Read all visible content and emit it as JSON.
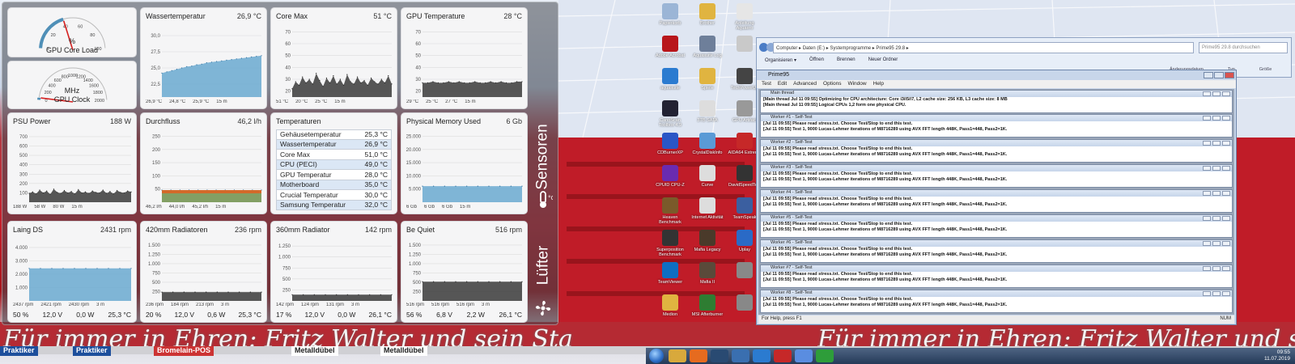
{
  "colors": {
    "accent": "#4f8fb7",
    "chart_fill": "#6aa9d0",
    "chart_dark": "#3a3a3a",
    "needle": "#d62020"
  },
  "gauges": [
    {
      "name": "GPU Core Load",
      "unit": "%",
      "ticks": [
        "0",
        "20",
        "40",
        "60",
        "80",
        "100"
      ],
      "level": 0.4
    },
    {
      "name": "GPU Clock",
      "unit": "MHz",
      "ticks": [
        "0",
        "200",
        "400",
        "600",
        "800",
        "1000",
        "1200",
        "1400",
        "1600",
        "1800",
        "2000"
      ],
      "level": 0.02
    }
  ],
  "tiles": {
    "wassertemperatur": {
      "title": "Wassertemperatur",
      "value": "26,9 °C",
      "chart_data": {
        "type": "area",
        "yticks": [
          "30,0",
          "27,5",
          "25,0",
          "22,5"
        ],
        "ylim": [
          20.5,
          31.5
        ],
        "values": [
          24.2,
          24.4,
          24.6,
          24.8,
          25.0,
          25.2,
          25.3,
          25.5,
          25.6,
          25.8,
          25.9,
          26.0,
          26.1,
          26.2,
          26.3,
          26.4,
          26.5,
          26.6,
          26.7,
          26.8,
          26.9
        ]
      },
      "footer": [
        "26,9 °C",
        "24,8 °C",
        "25,9 °C",
        "15 m"
      ]
    },
    "coremax": {
      "title": "Core Max",
      "value": "51 °C",
      "chart_data": {
        "type": "area",
        "yticks": [
          "70",
          "60",
          "50",
          "40",
          "30",
          "20"
        ],
        "ylim": [
          15,
          75
        ],
        "values": [
          22,
          28,
          25,
          32,
          27,
          30,
          26,
          35,
          29,
          24,
          31,
          27,
          33,
          26,
          30,
          25,
          34,
          28,
          26,
          32,
          27,
          29,
          25,
          31,
          28,
          26,
          30,
          27,
          33,
          26
        ]
      },
      "footer": [
        "51 °C",
        "20 °C",
        "25 °C",
        "15 m"
      ]
    },
    "gputemp": {
      "title": "GPU Temperature",
      "value": "28 °C",
      "chart_data": {
        "type": "area",
        "yticks": [
          "70",
          "60",
          "50",
          "40",
          "30",
          "20"
        ],
        "ylim": [
          15,
          75
        ],
        "values": [
          27,
          27,
          28,
          27,
          27,
          28,
          27,
          28,
          27,
          27,
          28,
          27,
          27,
          28,
          27,
          28,
          27,
          27,
          28,
          28
        ]
      },
      "footer": [
        "29 °C",
        "25 °C",
        "27 °C",
        "15 m"
      ]
    },
    "psu": {
      "title": "PSU Power",
      "value": "188 W",
      "chart_data": {
        "type": "area",
        "yticks": [
          "700",
          "600",
          "500",
          "400",
          "300",
          "200",
          "100"
        ],
        "ylim": [
          0,
          760
        ],
        "values": [
          95,
          110,
          90,
          130,
          100,
          120,
          85,
          140,
          105,
          95,
          125,
          100,
          115,
          90,
          135,
          100,
          110,
          95,
          120,
          105,
          100,
          130,
          95,
          115,
          90,
          125,
          105,
          100,
          120,
          110
        ]
      },
      "footer": [
        "188 W",
        "58 W",
        "80 W",
        "15 m"
      ]
    },
    "durchfluss": {
      "title": "Durchfluss",
      "value": "46,2 l/h",
      "chart_data": {
        "type": "area",
        "yticks": [
          "250",
          "200",
          "150",
          "100",
          "50"
        ],
        "ylim": [
          0,
          270
        ],
        "values": [
          46,
          46,
          46,
          46,
          46,
          46,
          46,
          46,
          46,
          46,
          46,
          46
        ]
      },
      "footer": [
        "46,2 l/h",
        "44,0 l/h",
        "45,2 l/h",
        "15 m"
      ]
    },
    "memory": {
      "title": "Physical Memory Used",
      "value": "6 Gb",
      "chart_data": {
        "type": "area",
        "yticks": [
          "25.000",
          "20.000",
          "15.000",
          "10.000",
          "5.000"
        ],
        "ylim": [
          0,
          27000
        ],
        "values": [
          6100,
          6100,
          6100,
          6100,
          6100,
          6100,
          6100,
          6100,
          6100,
          6100
        ]
      },
      "footer": [
        "6 Gb",
        "6 Gb",
        "6 Gb",
        "15 m"
      ]
    },
    "temperaturen": {
      "title": "Temperaturen",
      "rows": [
        {
          "label": "Gehäusetemperatur",
          "value": "25,3 °C"
        },
        {
          "label": "Wassertemperatur",
          "value": "26,9 °C"
        },
        {
          "label": "Core Max",
          "value": "51,0 °C"
        },
        {
          "label": "CPU (PECI)",
          "value": "49,0 °C"
        },
        {
          "label": "GPU Temperatur",
          "value": "28,0 °C"
        },
        {
          "label": "Motherboard",
          "value": "35,0 °C"
        },
        {
          "label": "Crucial Temperatur",
          "value": "30,0 °C"
        },
        {
          "label": "Samsung Temperatur",
          "value": "32,0 °C"
        }
      ]
    },
    "laing": {
      "title": "Laing DS",
      "value": "2431 rpm",
      "chart_data": {
        "type": "area",
        "yticks": [
          "4.000",
          "3.000",
          "2.000",
          "1.000"
        ],
        "ylim": [
          0,
          4600
        ],
        "values": [
          2431,
          2431,
          2431,
          2431,
          2431,
          2431,
          2431,
          2431,
          2431,
          2431
        ]
      },
      "footer": [
        "2437 rpm",
        "2421 rpm",
        "2430 rpm",
        "3 m"
      ],
      "stats": [
        "50 %",
        "12,0 V",
        "0,0 W",
        "25,3 °C"
      ]
    },
    "rad420": {
      "title": "420mm Radiatoren",
      "value": "236 rpm",
      "chart_data": {
        "type": "area",
        "yticks": [
          "1.500",
          "1.250",
          "1.000",
          "750",
          "500",
          "250"
        ],
        "ylim": [
          0,
          1650
        ],
        "values": [
          236,
          236,
          236,
          236,
          236,
          236,
          236,
          236,
          236,
          236
        ]
      },
      "footer": [
        "236 rpm",
        "184 rpm",
        "213 rpm",
        "3 m"
      ],
      "stats": [
        "20 %",
        "12,0 V",
        "0,6 W",
        "25,3 °C"
      ]
    },
    "rad360": {
      "title": "360mm Radiator",
      "value": "142 rpm",
      "chart_data": {
        "type": "area",
        "yticks": [
          "1.250",
          "1.000",
          "750",
          "500",
          "250"
        ],
        "ylim": [
          0,
          1400
        ],
        "values": [
          142,
          142,
          142,
          142,
          142,
          142,
          142,
          142,
          142,
          142
        ]
      },
      "footer": [
        "142 rpm",
        "124 rpm",
        "131 rpm",
        "3 m"
      ],
      "stats": [
        "17 %",
        "12,0 V",
        "0,0 W",
        "26,1 °C"
      ]
    },
    "bequiet": {
      "title": "Be Quiet",
      "value": "516 rpm",
      "chart_data": {
        "type": "area",
        "yticks": [
          "1.500",
          "1.250",
          "1.000",
          "750",
          "500",
          "250"
        ],
        "ylim": [
          0,
          1650
        ],
        "values": [
          516,
          516,
          516,
          516,
          516,
          516,
          516,
          516,
          516,
          516
        ]
      },
      "footer": [
        "516 rpm",
        "516 rpm",
        "516 rpm",
        "3 m"
      ],
      "stats": [
        "56 %",
        "6,8 V",
        "2,2 W",
        "26,1 °C"
      ]
    }
  },
  "side_tabs": {
    "sensors": "Sensoren",
    "fans": "Lüfter"
  },
  "desktop_icons": [
    {
      "label": "Papierkorb",
      "color": "#9bb5d6"
    },
    {
      "label": "Brother",
      "color": "#e0b440"
    },
    {
      "label": "Anleitung Aquaero",
      "color": "#e6e6e6"
    },
    {
      "label": "Adobe Acrobat",
      "color": "#b8161b"
    },
    {
      "label": "Aquasuite Log",
      "color": "#6e7f9a"
    },
    {
      "label": "",
      "color": "#c9c9c9"
    },
    {
      "label": "aquasuite",
      "color": "#2b7bd0"
    },
    {
      "label": "Spiele",
      "color": "#e0b440"
    },
    {
      "label": "TechPowerUp",
      "color": "#444"
    },
    {
      "label": "CanoScan Toolbox 4.9",
      "color": "#223"
    },
    {
      "label": "3TB SATA",
      "color": "#ddd"
    },
    {
      "label": "GPU Artifact",
      "color": "#999"
    },
    {
      "label": "CDBurnerXP",
      "color": "#2a56c6"
    },
    {
      "label": "CrystalDiskInfo",
      "color": "#5a9ad6"
    },
    {
      "label": "AIDA64 Extreme",
      "color": "#c62828"
    },
    {
      "label": "CPUID CPU-Z",
      "color": "#6a2bb0"
    },
    {
      "label": "Curve",
      "color": "#ddd"
    },
    {
      "label": "DavidSpeedTest",
      "color": "#333"
    },
    {
      "label": "Heaven Benchmark",
      "color": "#7a5a2a"
    },
    {
      "label": "Internet Aktivität",
      "color": "#ddd"
    },
    {
      "label": "TeamSpeak",
      "color": "#3b5fa0"
    },
    {
      "label": "Superposition Benchmark",
      "color": "#333"
    },
    {
      "label": "Mafia Legacy",
      "color": "#4a3a2a"
    },
    {
      "label": "Uplay",
      "color": "#2a6ac6"
    },
    {
      "label": "TeamViewer",
      "color": "#0e6ec2"
    },
    {
      "label": "Mafia II",
      "color": "#5a4a3a"
    },
    {
      "label": "",
      "color": "#888"
    },
    {
      "label": "Medion",
      "color": "#e0b440"
    },
    {
      "label": "MSI Afterburner",
      "color": "#2e7d32"
    },
    {
      "label": "",
      "color": "#888"
    }
  ],
  "explorer": {
    "address": "Computer ▸ Daten (E:) ▸ Systemprogramme ▸ Prime95 29.8 ▸",
    "search_placeholder": "Prime95 29.8 durchsuchen",
    "menu": [
      "Organisieren ▾",
      "Öffnen",
      "Brennen",
      "Neuer Ordner"
    ],
    "columns": [
      "Änderungsdatum",
      "Typ",
      "Größe"
    ]
  },
  "prime95": {
    "title": "Prime95",
    "menu": [
      "Test",
      "Edit",
      "Advanced",
      "Options",
      "Window",
      "Help"
    ],
    "main": {
      "title": "Main thread",
      "lines": [
        "[Main thread Jul 11 09:55] Optimizing for CPU architecture: Core i3/i5/i7, L2 cache size: 256 KB, L3 cache size: 8 MB",
        "[Main thread Jul 11 09:55] Logical CPUs 1,2 form one physical CPU."
      ]
    },
    "workers": [
      {
        "title": "Worker #1 - Self-Test",
        "lines": [
          "[Jul 11 09:55] Please read stress.txt.  Choose Test/Stop to end this test.",
          "[Jul 11 09:55] Test 1, 9000 Lucas-Lehmer iterations of M8716289 using AVX FFT length 448K, Pass1=448, Pass2=1K."
        ]
      },
      {
        "title": "Worker #2 - Self-Test",
        "lines": [
          "[Jul 11 09:55] Please read stress.txt.  Choose Test/Stop to end this test.",
          "[Jul 11 09:55] Test 1, 9000 Lucas-Lehmer iterations of M8716289 using AVX FFT length 448K, Pass1=448, Pass2=1K."
        ]
      },
      {
        "title": "Worker #3 - Self-Test",
        "lines": [
          "[Jul 11 09:55] Please read stress.txt.  Choose Test/Stop to end this test.",
          "[Jul 11 09:55] Test 1, 9000 Lucas-Lehmer iterations of M8716289 using AVX FFT length 448K, Pass1=448, Pass2=1K."
        ]
      },
      {
        "title": "Worker #4 - Self-Test",
        "lines": [
          "[Jul 11 09:55] Please read stress.txt.  Choose Test/Stop to end this test.",
          "[Jul 11 09:55] Test 1, 9000 Lucas-Lehmer iterations of M8716289 using AVX FFT length 448K, Pass1=448, Pass2=1K."
        ]
      },
      {
        "title": "Worker #5 - Self-Test",
        "lines": [
          "[Jul 11 09:55] Please read stress.txt.  Choose Test/Stop to end this test.",
          "[Jul 11 09:55] Test 1, 9000 Lucas-Lehmer iterations of M8716289 using AVX FFT length 448K, Pass1=448, Pass2=1K."
        ]
      },
      {
        "title": "Worker #6 - Self-Test",
        "lines": [
          "[Jul 11 09:55] Please read stress.txt.  Choose Test/Stop to end this test.",
          "[Jul 11 09:55] Test 1, 9000 Lucas-Lehmer iterations of M8716289 using AVX FFT length 448K, Pass1=448, Pass2=1K."
        ]
      },
      {
        "title": "Worker #7 - Self-Test",
        "lines": [
          "[Jul 11 09:55] Please read stress.txt.  Choose Test/Stop to end this test.",
          "[Jul 11 09:55] Test 1, 9000 Lucas-Lehmer iterations of M8716289 using AVX FFT length 448K, Pass1=448, Pass2=1K."
        ]
      },
      {
        "title": "Worker #8 - Self-Test",
        "lines": [
          "[Jul 11 09:55] Please read stress.txt.  Choose Test/Stop to end this test.",
          "[Jul 11 09:55] Test 1, 9000 Lucas-Lehmer iterations of M8716289 using AVX FFT length 448K, Pass1=448, Pass2=1K."
        ]
      }
    ],
    "status_left": "For Help, press F1",
    "status_right": "NUM"
  },
  "banner": {
    "script": "Für immer in Ehren: Fritz Walter und sein Sta",
    "script2": "Für immer in Ehren: Fritz Walter und sein Sta"
  },
  "ads": [
    "Praktiker",
    "Praktiker",
    "Bromelain-POS",
    "Metalldübel",
    "Metalldübel"
  ],
  "taskbar": {
    "time": "09:55",
    "date": "11.07.2019"
  }
}
